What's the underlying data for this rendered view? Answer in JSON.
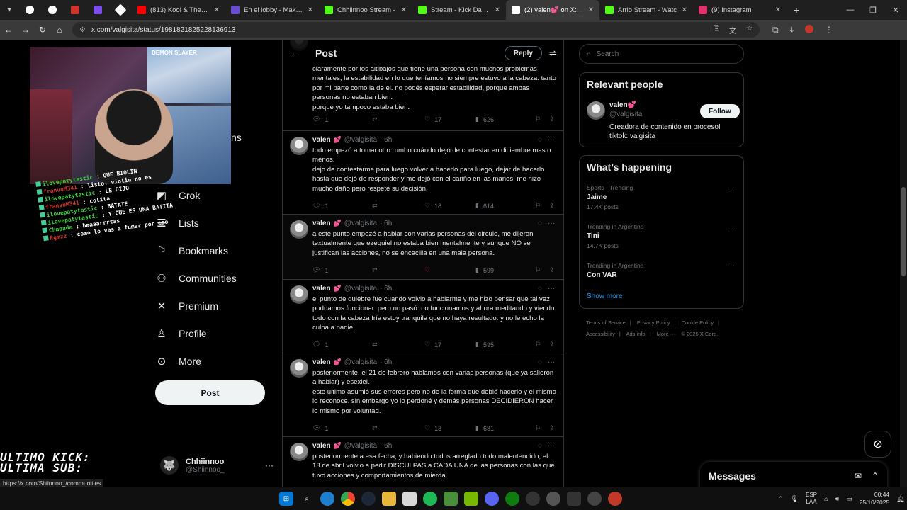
{
  "browser": {
    "tabs": [
      {
        "label": "",
        "favicon_color": "#ffffff"
      },
      {
        "label": "",
        "favicon_color": "#ffffff"
      },
      {
        "label": "",
        "favicon_color": "#d0342c"
      },
      {
        "label": "",
        "favicon_color": "#7b4cf0"
      },
      {
        "label": "",
        "favicon_color": "#ffffff"
      },
      {
        "label": "(813) Kool & The Gang",
        "favicon_color": "#ff0000"
      },
      {
        "label": "En el lobby - Make it M",
        "favicon_color": "#6a4cd0"
      },
      {
        "label": "Chhiinnoo Stream -",
        "favicon_color": "#53fc18"
      },
      {
        "label": "Stream - Kick Dashboar",
        "favicon_color": "#53fc18"
      },
      {
        "label": "(2) valen💕 on X: \"el pr",
        "favicon_color": "#ffffff"
      },
      {
        "label": "Arrio Stream - Watc",
        "favicon_color": "#53fc18"
      },
      {
        "label": "(9) Instagram",
        "favicon_color": "#e1306c"
      }
    ],
    "url": "x.com/valgisita/status/1981821825228136913",
    "status_url": "https://x.com/Shiinnoo_/communities"
  },
  "stream_overlay": {
    "poster_text": "DEMON SLAYER",
    "chat": [
      {
        "user": "ilovepatytastic",
        "msg": ": QUE BIOLIN",
        "color": "green"
      },
      {
        "user": "franvoM341",
        "msg": ": listo, violin no es",
        "color": "red"
      },
      {
        "user": "ilovepatytastic",
        "msg": ": LE DIJO",
        "color": "green"
      },
      {
        "user": "franvoM341",
        "msg": ": colita",
        "color": "red"
      },
      {
        "user": "ilovepatytastic",
        "msg": ": BATATE",
        "color": "green"
      },
      {
        "user": "ilovepatytastic",
        "msg": ": Y QUE ES UNA BATITA",
        "color": "green"
      },
      {
        "user": "Chapadm",
        "msg": ": baaaarrrtas",
        "color": "green"
      },
      {
        "user": "Rgmzz",
        "msg": ": como lo vas a fumar por eso",
        "color": "red"
      }
    ],
    "bottom_lines": [
      "ULTIMO KICK:",
      "ULTIMA SUB:"
    ],
    "partial_text": "ns"
  },
  "nav": {
    "items": [
      {
        "label": "Grok",
        "icon": "grok-icon"
      },
      {
        "label": "Lists",
        "icon": "lists-icon"
      },
      {
        "label": "Bookmarks",
        "icon": "bookmark-icon"
      },
      {
        "label": "Communities",
        "icon": "communities-icon"
      },
      {
        "label": "Premium",
        "icon": "x-logo-icon"
      },
      {
        "label": "Profile",
        "icon": "profile-icon"
      },
      {
        "label": "More",
        "icon": "more-icon"
      }
    ],
    "post_label": "Post",
    "account": {
      "name": "Chhiinnoo",
      "handle": "@Shiinnoo_"
    }
  },
  "feed": {
    "title": "Post",
    "reply_label": "Reply",
    "tweets": [
      {
        "name": "",
        "handle": "",
        "time": "",
        "body": "claramente por los altibajos que tiene una persona con muchos problemas mentales, la estabilidad en lo que teníamos no siempre estuvo a la cabeza. tanto por mi parte como la de el. no podés esperar estabilidad, porque ambas personas no estaban bien.\nporque yo tampoco estaba bien.",
        "replies": "1",
        "reposts": "",
        "likes": "17",
        "views": "626",
        "liked": false
      },
      {
        "name": "valen",
        "handle": "@valgisita",
        "time": "· 6h",
        "body": "todo empezó a tomar otro rumbo cuándo dejó de contestar en diciembre mas o menos.\ndejo de contestarme para luego volver a hacerlo para luego, dejar de hacerlo hasta que dejó de responder y me dejó con el cariño en las manos. me hizo mucho daño pero respeté su decisión.",
        "replies": "1",
        "reposts": "",
        "likes": "18",
        "views": "614",
        "liked": false
      },
      {
        "name": "valen",
        "handle": "@valgisita",
        "time": "· 6h",
        "body": "a este punto empezé a hablar con varias personas del circulo, me dijeron textualmente que ezequiel no estaba bien mentalmente y aunque NO se justifican las acciones, no se encacilla en una mala persona.",
        "replies": "1",
        "reposts": "",
        "likes": "",
        "views": "599",
        "liked": true
      },
      {
        "name": "valen",
        "handle": "@valgisita",
        "time": "· 6h",
        "body": "el punto de quiebre fue cuando volvio a hablarme y me hizo pensar que tal vez podriamos funcionar. pero no pasó. no funcionamos y ahora meditando y viendo todo con la cabeza fría estoy tranquila que no haya resultado. y no le echo la culpa a nadie.",
        "replies": "1",
        "reposts": "",
        "likes": "17",
        "views": "595",
        "liked": false
      },
      {
        "name": "valen",
        "handle": "@valgisita",
        "time": "· 6h",
        "body": "posteriormente, el 21 de febrero hablamos con varias personas (que ya salieron a hablar) y esexiel.\neste ultimo asumió sus errores pero no de la forma que debió hacerlo y el mismo lo reconoce. sin embargo yo lo perdoné y demás personas DECIDIERON hacer lo mismo por voluntad.",
        "replies": "1",
        "reposts": "",
        "likes": "18",
        "views": "681",
        "liked": false
      },
      {
        "name": "valen",
        "handle": "@valgisita",
        "time": "· 6h",
        "body": "posteriormente a esa fecha, y habiendo todos arreglado todo malentendido, el 13 de abril volvio a pedir DISCULPAS a CADA UNA de las personas con las que tuvo acciones y comportamientos de mierda.",
        "replies": "",
        "reposts": "",
        "likes": "",
        "views": "",
        "liked": false
      }
    ]
  },
  "sidebar": {
    "search_placeholder": "Search",
    "relevant_title": "Relevant people",
    "person": {
      "name": "valen💕",
      "handle": "@valgisita",
      "bio": "Creadora de contenido en proceso!\ntiktok: valgisita",
      "follow_label": "Follow"
    },
    "happening_title": "What’s happening",
    "trends": [
      {
        "context": "Sports · Trending",
        "title": "Jaime",
        "count": "17.4K posts"
      },
      {
        "context": "Trending in Argentina",
        "title": "Tini",
        "count": "14.7K posts"
      },
      {
        "context": "Trending in Argentina",
        "title": "Con VAR",
        "count": ""
      }
    ],
    "show_more": "Show more",
    "footer_links": [
      "Terms of Service",
      "|",
      "Privacy Policy",
      "|",
      "Cookie Policy",
      "|",
      "Accessibility",
      "|",
      "Ads info",
      "|",
      "More ···",
      "© 2025 X Corp."
    ]
  },
  "messages": {
    "title": "Messages"
  },
  "taskbar": {
    "lang_top": "ESP",
    "lang_bottom": "LAA",
    "time": "00:44",
    "date": "25/10/2025"
  }
}
